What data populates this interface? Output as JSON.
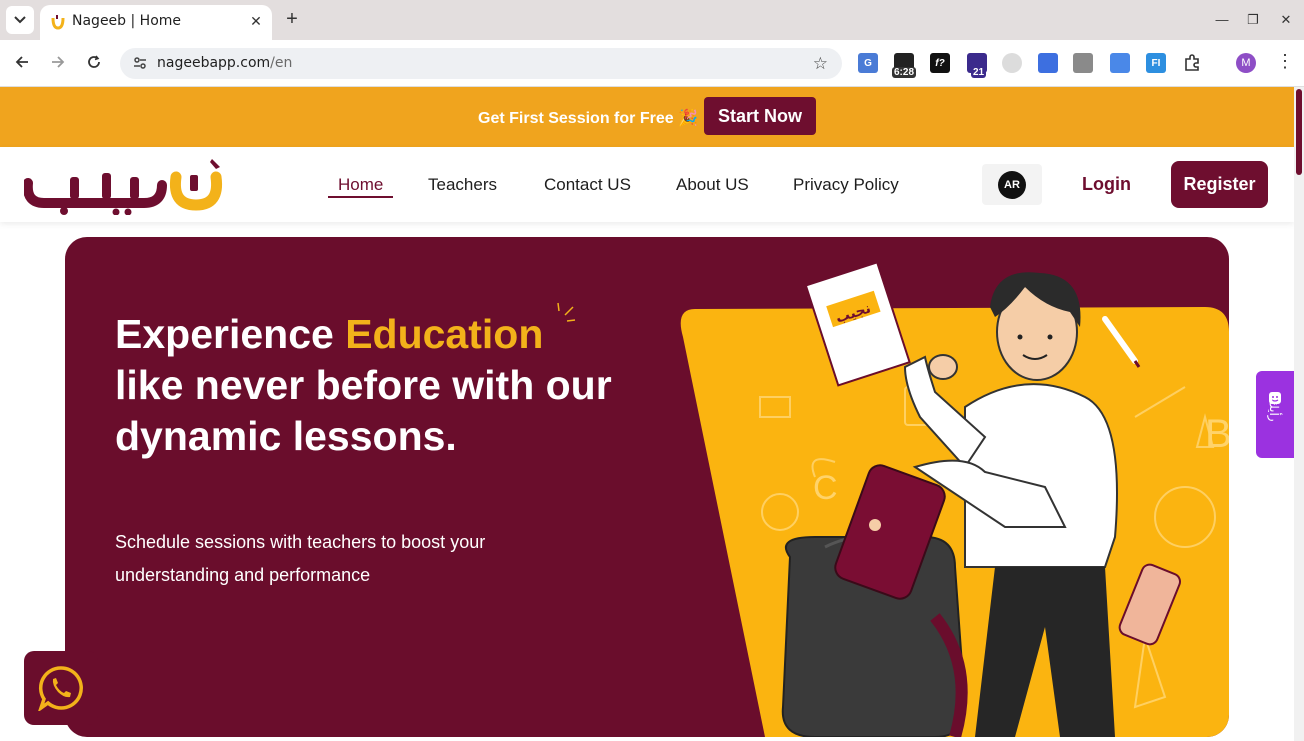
{
  "browser": {
    "tab_title": "Nageeb | Home",
    "url_host": "nageebapp.com",
    "url_path": "/en",
    "ext_time_badge": "6:28",
    "ext_count_badge": "21",
    "profile_initial": "M"
  },
  "promo": {
    "text": "Get First Session for Free 🎉",
    "cta": "Start Now"
  },
  "header": {
    "nav": [
      "Home",
      "Teachers",
      "Contact US",
      "About US",
      "Privacy Policy"
    ],
    "lang": "AR",
    "login": "Login",
    "register": "Register"
  },
  "hero": {
    "title_part1": "Experience ",
    "title_accent": "Education",
    "title_part2": "like never before with our dynamic lessons.",
    "subtitle": "Schedule sessions with teachers to boost your understanding and performance",
    "book_label": "نجيب"
  },
  "feedback": {
    "label": "رأيك"
  },
  "colors": {
    "brand": "#6e0e2f",
    "accent": "#f3b21a",
    "promo_bg": "#f0a41e",
    "feedback_bg": "#9b32e0"
  }
}
